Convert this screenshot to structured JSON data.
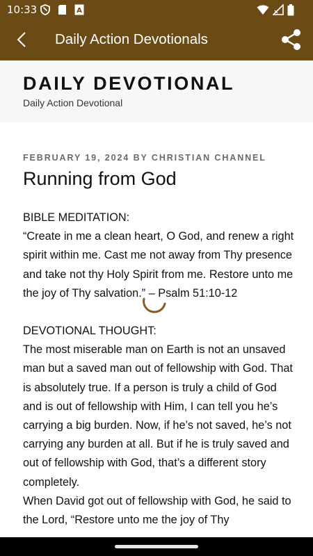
{
  "status_bar": {
    "time": "10:33",
    "icons": [
      "shield-icon",
      "sim-card-icon",
      "text-a-icon",
      "wifi-icon",
      "signal-icon",
      "battery-icon"
    ]
  },
  "app_bar": {
    "title": "Daily Action Devotionals",
    "back_icon": "back-arrow-icon",
    "share_icon": "share-icon",
    "background": "#6b4a16"
  },
  "site_header": {
    "title": "DAILY DEVOTIONAL",
    "tagline": "Daily Action Devotional"
  },
  "post": {
    "date": "FEBRUARY 19, 2024",
    "by": "BY",
    "author": "CHRISTIAN CHANNEL",
    "title": "Running from God",
    "paragraphs": [
      "BIBLE MEDITATION:",
      "“Create in me a clean heart, O God, and renew a right spirit within me. Cast me not away from Thy presence and take not thy Holy Spirit from me. Restore unto me the joy of Thy salvation.” – Psalm 51:10-12",
      "DEVOTIONAL THOUGHT:",
      "The most miserable man on Earth is not an unsaved man but a saved man out of fellowship with God. That is absolutely true. If a person is truly a child of God and is out of fellowship with Him, I can tell you he’s carrying a big burden. Now, if he’s not saved, he’s not carrying any burden at all. But if he is truly saved and out of fellowship with God, that’s a different story completely.",
      "When David got out of fellowship with God, he said to the Lord, “Restore unto me the joy of Thy"
    ]
  },
  "loading_indicator": "loading-spinner",
  "accent_color": "#8a5a1c"
}
